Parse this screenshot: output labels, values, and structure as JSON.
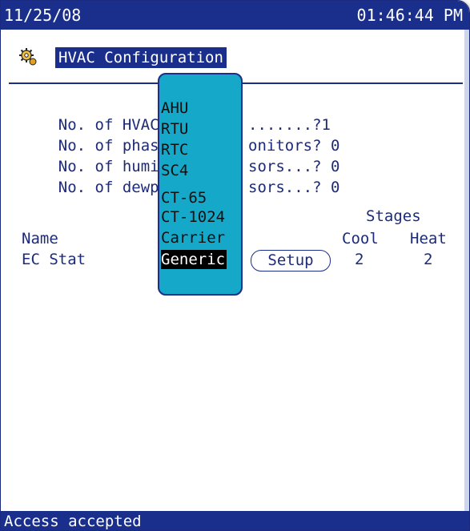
{
  "header": {
    "date": "11/25/08",
    "time": "01:46:44 PM"
  },
  "title": {
    "text": "HVAC  Configuration"
  },
  "rows": [
    {
      "label_left": "No. of HVAC ",
      "label_right": ".......?1"
    },
    {
      "label_left": "No. of phase",
      "label_right": "onitors? 0"
    },
    {
      "label_left": "No. of humid",
      "label_right": "sors...? 0"
    },
    {
      "label_left": "No. of dewpo",
      "label_right": "sors...? 0"
    }
  ],
  "table": {
    "stages_header": "Stages",
    "col_name": "Name",
    "col_cool": "Cool",
    "col_heat": "Heat",
    "row_name": "EC Stat",
    "row_cool": "2",
    "row_heat": "2",
    "setup_label": "Setup"
  },
  "dropdown": {
    "options": [
      "AHU",
      "RTU",
      "RTC",
      "SC4",
      "CT-65",
      "CT-1024",
      "Carrier",
      "Generic"
    ],
    "selected": "Generic"
  },
  "status": {
    "text": "Access accepted"
  },
  "colors": {
    "bar": "#1a2e8c",
    "dropdown": "#16a8c8",
    "text": "#1c2a7a"
  }
}
